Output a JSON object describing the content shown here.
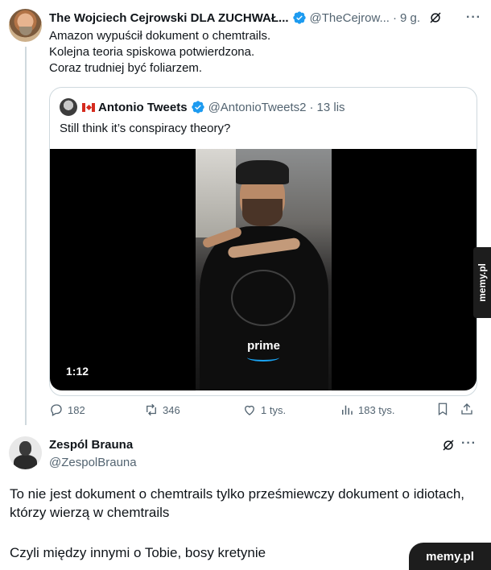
{
  "tweet1": {
    "name": "The Wojciech Cejrowski DLA ZUCHWAŁ...",
    "handle": "@TheCejrow...",
    "separator": "·",
    "time": "9 g.",
    "more": "···",
    "lines": [
      "Amazon wypuścił dokument o chemtrails.",
      "Kolejna teoria spiskowa potwierdzona.",
      "Coraz trudniej być foliarzem."
    ],
    "quote": {
      "name": "Antonio Tweets",
      "handle": "@AntonioTweets2",
      "separator": "·",
      "time": "13 lis",
      "text": "Still think it’s conspiracy theory?",
      "video": {
        "duration": "1:12",
        "brand_text": "prime"
      }
    },
    "actions": {
      "replies": "182",
      "retweets": "346",
      "likes": "1 tys.",
      "views": "183 tys."
    }
  },
  "tweet2": {
    "name": "Zespól Brauna",
    "handle": "@ZespolBrauna",
    "more": "···",
    "paragraphs": [
      "To nie jest dokument o chemtrails tylko prześmiewczy dokument o idiotach, którzy wierzą w chemtrails",
      "Czyli między innymi o Tobie, bosy kretynie"
    ]
  },
  "watermark": {
    "side": "memy.pl",
    "corner": "memy.pl"
  },
  "colors": {
    "verified": "#1d9bf0",
    "secondary_text": "#536471",
    "border": "#cfd9de",
    "canada_red": "#d52b1e"
  }
}
